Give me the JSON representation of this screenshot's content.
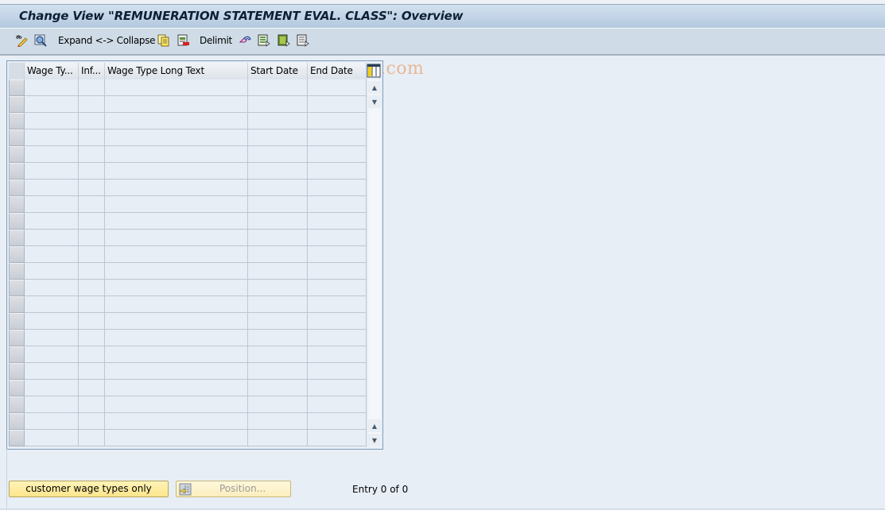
{
  "window": {
    "title": "Change View \"REMUNERATION STATEMENT EVAL. CLASS\": Overview"
  },
  "toolbar": {
    "items": [
      {
        "name": "display-change-icon",
        "label": ""
      },
      {
        "name": "details-icon",
        "label": ""
      },
      {
        "name": "expand-collapse",
        "label": "Expand <-> Collapse"
      },
      {
        "name": "copy-icon",
        "label": ""
      },
      {
        "name": "delete-icon",
        "label": ""
      },
      {
        "name": "delimit",
        "label": "Delimit"
      },
      {
        "name": "undo-icon",
        "label": ""
      },
      {
        "name": "select-all-icon",
        "label": ""
      },
      {
        "name": "select-block-icon",
        "label": ""
      },
      {
        "name": "deselect-all-icon",
        "label": ""
      }
    ],
    "watermark": "©www.tutorialkart.com"
  },
  "table": {
    "columns": [
      {
        "key": "wage_type",
        "label": "Wage Ty..."
      },
      {
        "key": "infotype",
        "label": "Inf..."
      },
      {
        "key": "long_text",
        "label": "Wage Type Long Text"
      },
      {
        "key": "start_date",
        "label": "Start Date"
      },
      {
        "key": "end_date",
        "label": "End Date"
      }
    ],
    "rows": [],
    "visible_empty_rows": 22
  },
  "footer": {
    "customer_button": "customer wage types only",
    "position_button": "Position...",
    "entry_text": "Entry 0 of 0"
  }
}
